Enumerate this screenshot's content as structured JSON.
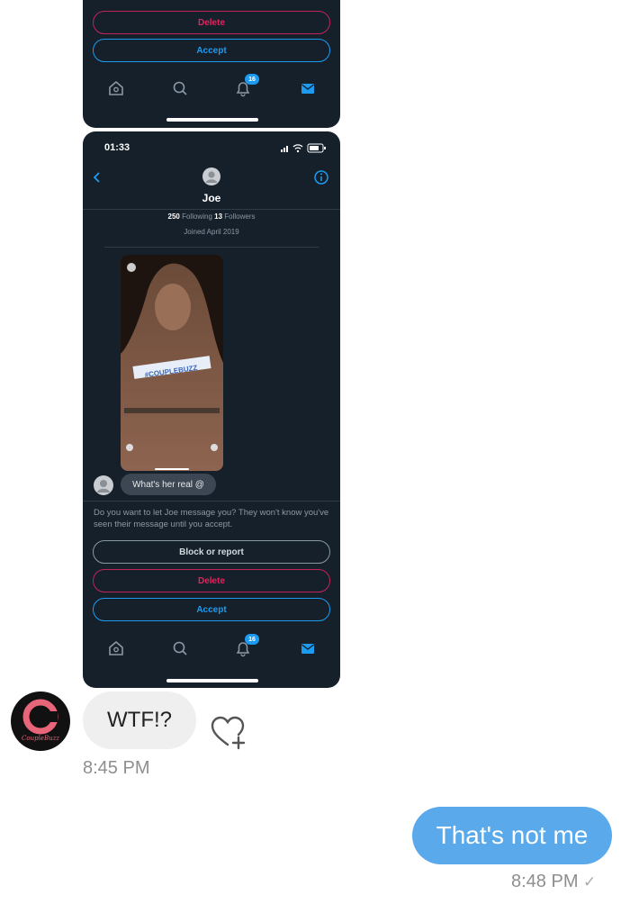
{
  "top_screenshot": {
    "delete_label": "Delete",
    "accept_label": "Accept",
    "notification_badge": "16"
  },
  "main_screenshot": {
    "status_time": "01:33",
    "profile": {
      "name": "Joe",
      "following_count": "250",
      "following_label": "Following",
      "followers_count": "13",
      "followers_label": "Followers",
      "joined": "Joined April 2019"
    },
    "story_caption": "#COUPLEBUZZ",
    "reply_text": "What's her real @",
    "request_text": "Do you want to let Joe message you? They won't know you've seen their message until you accept.",
    "block_label": "Block or report",
    "delete_label": "Delete",
    "accept_label": "Accept",
    "notification_badge": "16"
  },
  "avatar_text": "CoupleBuzz",
  "received_message": {
    "text": "WTF!?",
    "time": "8:45 PM"
  },
  "sent_message": {
    "text": "That's not me",
    "time": "8:48 PM",
    "read_mark": "✓"
  },
  "colors": {
    "dark_bg": "#15202b",
    "twitter_blue": "#1d9bf0",
    "delete_red": "#e0245e",
    "sent_bubble": "#5aa9ea",
    "received_bubble": "#efefef"
  }
}
